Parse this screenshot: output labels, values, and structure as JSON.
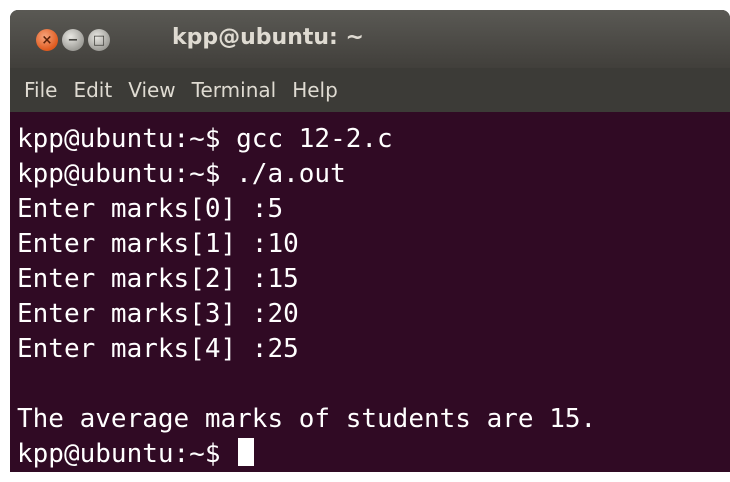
{
  "window": {
    "title": "kpp@ubuntu: ~"
  },
  "titlebar_buttons": {
    "close_glyph": "×",
    "minimize_glyph": "−",
    "maximize_glyph": "□"
  },
  "menu": {
    "items": [
      "File",
      "Edit",
      "View",
      "Terminal",
      "Help"
    ]
  },
  "terminal": {
    "lines": [
      "kpp@ubuntu:~$ gcc 12-2.c",
      "kpp@ubuntu:~$ ./a.out",
      "Enter marks[0] :5",
      "Enter marks[1] :10",
      "Enter marks[2] :15",
      "Enter marks[3] :20",
      "Enter marks[4] :25",
      "",
      "The average marks of students are 15."
    ],
    "prompt": "kpp@ubuntu:~$ "
  },
  "colors": {
    "terminal_background": "#300a24",
    "terminal_text": "#ffffff",
    "titlebar": "#3c3b37",
    "close_button": "#e05a1e"
  }
}
